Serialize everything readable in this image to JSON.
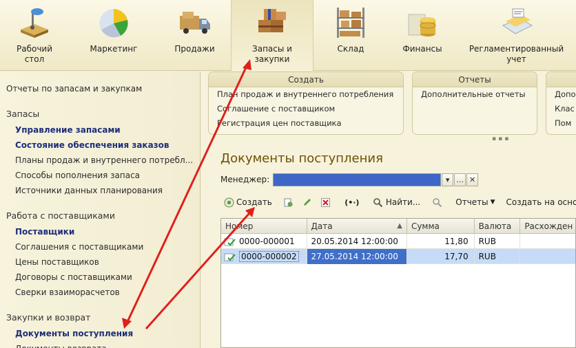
{
  "sections": [
    {
      "label": "Рабочий\nстол",
      "icon": "desk-icon"
    },
    {
      "label": "Маркетинг",
      "icon": "pie-chart-icon"
    },
    {
      "label": "Продажи",
      "icon": "truck-icon"
    },
    {
      "label": "Запасы и\nзакупки",
      "icon": "boxes-icon"
    },
    {
      "label": "Склад",
      "icon": "warehouse-shelf-icon"
    },
    {
      "label": "Финансы",
      "icon": "coins-icon"
    },
    {
      "label": "Регламентированный\nучет",
      "icon": "ledger-icon"
    }
  ],
  "leftnav": {
    "top_link": "Отчеты по запасам и закупкам",
    "groups": [
      {
        "title": "Запасы",
        "items": [
          {
            "label": "Управление запасами",
            "bold": true
          },
          {
            "label": "Состояние обеспечения заказов",
            "bold": true
          },
          {
            "label": "Планы продаж и внутреннего потребл...",
            "bold": false
          },
          {
            "label": "Способы пополнения запаса",
            "bold": false
          },
          {
            "label": "Источники данных планирования",
            "bold": false
          }
        ]
      },
      {
        "title": "Работа с поставщиками",
        "items": [
          {
            "label": "Поставщики",
            "bold": true
          },
          {
            "label": "Соглашения с поставщиками",
            "bold": false
          },
          {
            "label": "Цены поставщиков",
            "bold": false
          },
          {
            "label": "Договоры с поставщиками",
            "bold": false
          },
          {
            "label": "Сверки взаиморасчетов",
            "bold": false
          }
        ]
      },
      {
        "title": "Закупки и возврат",
        "items": [
          {
            "label": "Документы поступления",
            "bold": true
          },
          {
            "label": "Документы возврата",
            "bold": false
          }
        ]
      }
    ]
  },
  "panels": {
    "create": {
      "title": "Создать",
      "items": [
        "План продаж и внутреннего потребления",
        "Соглашение с поставщиком",
        "Регистрация цен поставщика"
      ]
    },
    "reports": {
      "title": "Отчеты",
      "items": [
        "Дополнительные отчеты"
      ]
    },
    "service": {
      "title": "",
      "items": [
        "Допо",
        "Клас",
        "Пом"
      ]
    }
  },
  "form": {
    "title": "Документы поступления",
    "manager_label": "Менеджер:",
    "manager_value": "",
    "toolbar": {
      "create": "Создать",
      "find": "Найти...",
      "reports": "Отчеты",
      "create_based": "Создать на основ"
    },
    "columns": [
      "Номер",
      "Дата",
      "Сумма",
      "Валюта",
      "Расхожден"
    ],
    "rows": [
      {
        "number": "0000-000001",
        "date": "20.05.2014 12:00:00",
        "sum": "11,80",
        "currency": "RUB",
        "selected": false
      },
      {
        "number": "0000-000002",
        "date": "27.05.2014 12:00:00",
        "sum": "17,70",
        "currency": "RUB",
        "selected": true
      }
    ]
  },
  "colors": {
    "arrow": "#e0201c",
    "title": "#6b5200",
    "link": "#1e2f7a",
    "selection": "#3f6fc9"
  }
}
